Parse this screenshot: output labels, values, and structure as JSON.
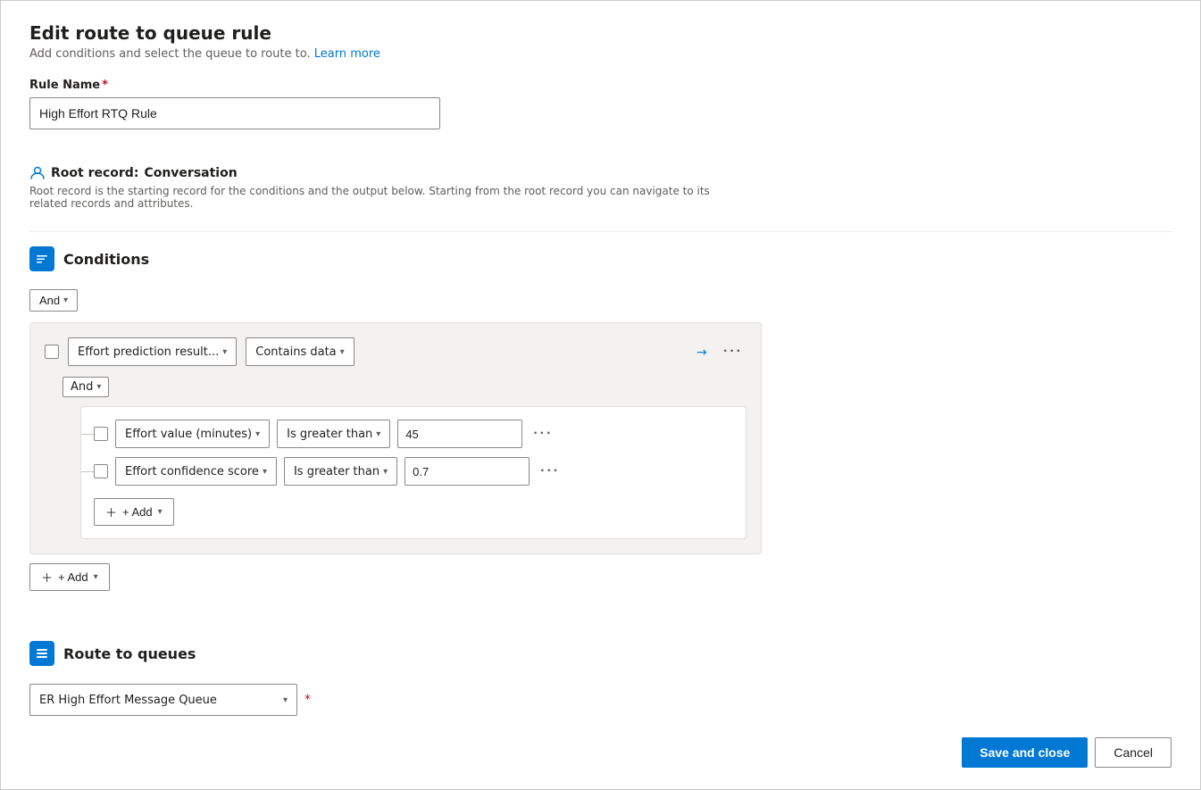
{
  "page": {
    "title": "Edit route to queue rule",
    "subtitle": "Add conditions and select the queue to route to.",
    "learn_more": "Learn more"
  },
  "rule_name_label": "Rule Name",
  "rule_name_value": "High Effort RTQ Rule",
  "root_record": {
    "label": "Root record:",
    "value": "Conversation",
    "description": "Root record is the starting record for the conditions and the output below. Starting from the root record you can navigate to its related records and attributes."
  },
  "conditions_section": {
    "title": "Conditions",
    "and_label": "And",
    "top_row": {
      "field": "Effort prediction result...",
      "operator": "Contains data"
    },
    "inner_and_label": "And",
    "condition1": {
      "field": "Effort value (minutes)",
      "operator": "Is greater than",
      "value": "45"
    },
    "condition2": {
      "field": "Effort confidence score",
      "operator": "Is greater than",
      "value": "0.7"
    },
    "add_label": "+ Add",
    "outer_add_label": "+ Add"
  },
  "route_queues_section": {
    "title": "Route to queues",
    "queue_value": "ER High Effort Message Queue"
  },
  "footer": {
    "save_close_label": "Save and close",
    "cancel_label": "Cancel"
  }
}
